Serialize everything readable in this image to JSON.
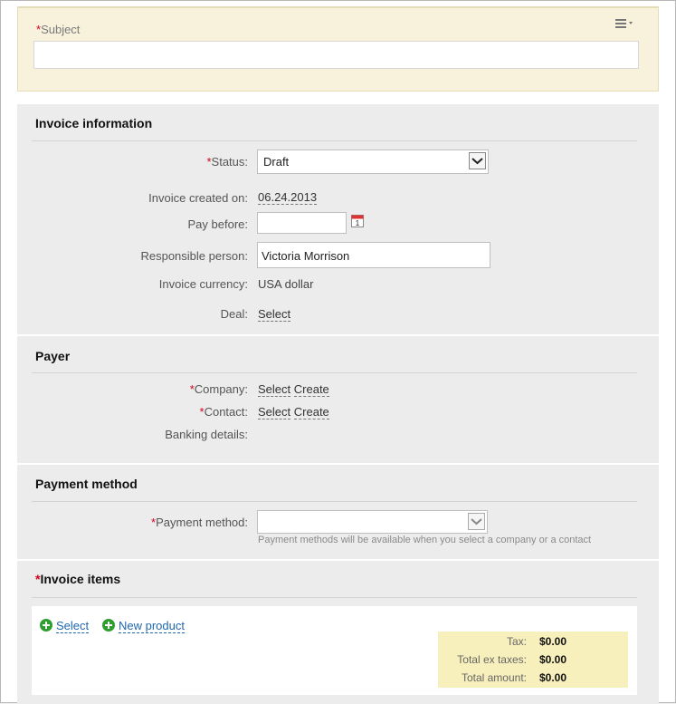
{
  "subject": {
    "required_mark": "*",
    "label": "Subject",
    "value": ""
  },
  "invoice_info": {
    "title": "Invoice information",
    "status": {
      "required_mark": "*",
      "label": "Status:",
      "value": "Draft"
    },
    "created_on": {
      "label": "Invoice created on:",
      "value": "06.24.2013"
    },
    "pay_before": {
      "label": "Pay before:",
      "value": "",
      "calendar_day": "1"
    },
    "responsible": {
      "label": "Responsible person:",
      "value": "Victoria Morrison"
    },
    "currency": {
      "label": "Invoice currency:",
      "value": "USA dollar"
    },
    "deal": {
      "label": "Deal:",
      "select_label": "Select"
    }
  },
  "payer": {
    "title": "Payer",
    "company": {
      "required_mark": "*",
      "label": "Company:",
      "select_label": "Select",
      "create_label": "Create"
    },
    "contact": {
      "required_mark": "*",
      "label": "Contact:",
      "select_label": "Select",
      "create_label": "Create"
    },
    "banking": {
      "label": "Banking details:"
    }
  },
  "payment": {
    "title": "Payment method",
    "method": {
      "required_mark": "*",
      "label": "Payment method:",
      "value": ""
    },
    "hint": "Payment methods will be available when you select a company or a contact"
  },
  "items": {
    "required_mark": "*",
    "title": "Invoice items",
    "select_label": "Select",
    "new_product_label": "New product",
    "totals": {
      "tax_label": "Tax:",
      "tax_value": "$0.00",
      "ex_label": "Total ex taxes:",
      "ex_value": "$0.00",
      "total_label": "Total amount:",
      "total_value": "$0.00"
    }
  },
  "colors": {
    "accent_link": "#2067b0",
    "required": "#d0021b",
    "subject_bg": "#f8f2dc",
    "totals_bg": "#f8f0bc",
    "plus_icon": "#2e9e2e"
  }
}
